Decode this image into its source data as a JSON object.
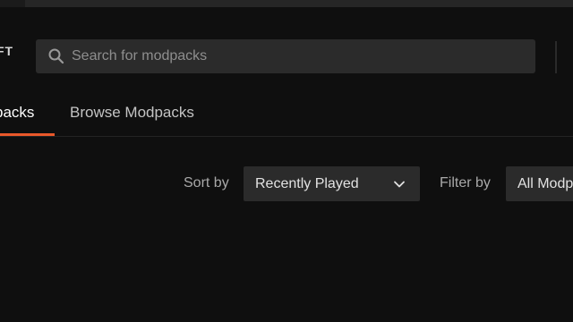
{
  "header": {
    "logo_text": "FT",
    "search": {
      "placeholder": "Search for modpacks",
      "value": "",
      "icon": "search-icon"
    }
  },
  "tabs": [
    {
      "label": "packs",
      "active": true
    },
    {
      "label": "Browse Modpacks",
      "active": false
    }
  ],
  "toolbar": {
    "sort_label": "Sort by",
    "sort_value": "Recently Played",
    "sort_icon": "chevron-down-icon",
    "filter_label": "Filter by",
    "filter_value": "All Modp"
  },
  "colors": {
    "background": "#0f0f0f",
    "surface": "#2b2b2b",
    "accent": "#e8582a",
    "text_primary": "#ffffff",
    "text_secondary": "#a9a9a9"
  }
}
